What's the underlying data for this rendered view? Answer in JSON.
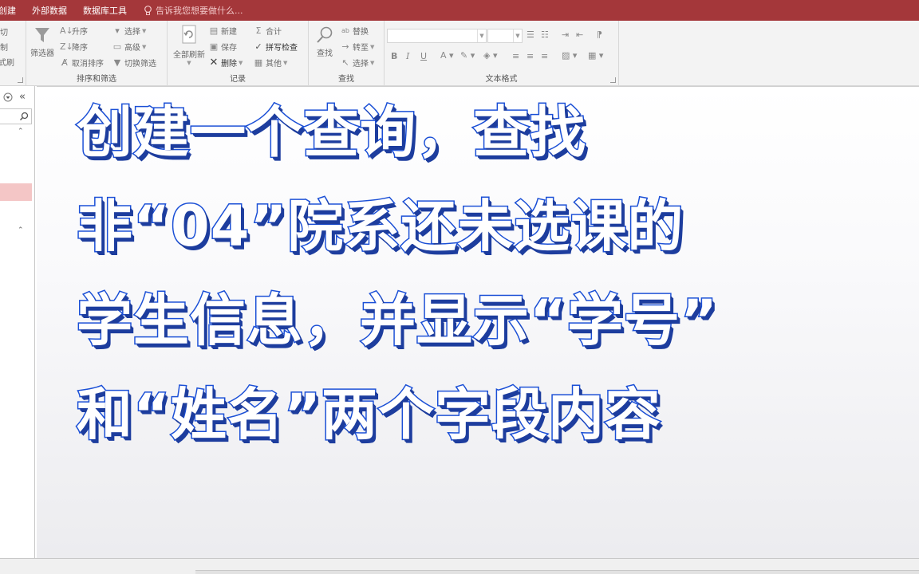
{
  "tabs": [
    "创建",
    "外部数据",
    "数据库工具"
  ],
  "tell_me": "告诉我您想要做什么...",
  "ribbon": {
    "clipboard": {
      "cut": "剪切",
      "copy": "复制",
      "painter": "格式刷"
    },
    "sort_filter": {
      "filter": "筛选器",
      "asc": "升序",
      "desc": "降序",
      "clear_sort": "取消排序",
      "selection": "选择",
      "advanced": "高级",
      "toggle_filter": "切换筛选",
      "label": "排序和筛选"
    },
    "records": {
      "refresh_all": "全部刷新",
      "new": "新建",
      "save": "保存",
      "delete": "删除",
      "totals": "合计",
      "spelling": "拼写检查",
      "more": "其他",
      "label": "记录"
    },
    "find": {
      "find": "查找",
      "replace": "替换",
      "goto": "转至",
      "select": "选择",
      "label": "查找"
    },
    "text_format": {
      "bold": "B",
      "italic": "I",
      "underline": "U",
      "label": "文本格式"
    }
  },
  "caption_lines": [
    "创建一个查询，查找",
    "非“04”院系还未选课的",
    "学生信息，并显示“学号”",
    "和“姓名”两个字段内容"
  ],
  "colors": {
    "tab_bar": "#a4373a",
    "caption_fill": "#ffffff",
    "caption_stroke": "#1a4fd6",
    "nav_selected": "#f4c6c6"
  }
}
